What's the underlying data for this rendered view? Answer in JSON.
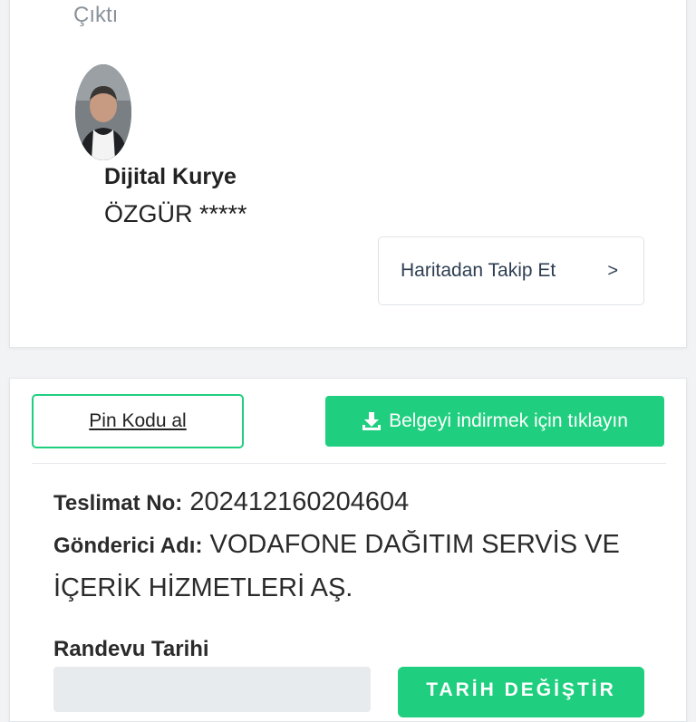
{
  "status": {
    "text": "Çıktı"
  },
  "courier": {
    "title": "Dijital Kurye",
    "name": "ÖZGÜR *****",
    "avatar_icon": "person-photo"
  },
  "map_button": {
    "label": "Haritadan Takip Et",
    "chevron": ">"
  },
  "actions": {
    "pin_label": "Pin Kodu al",
    "download_label": "Belgeyi indirmek için tıklayın",
    "download_icon": "download-icon"
  },
  "delivery": {
    "delivery_no_label": "Teslimat No:",
    "delivery_no_value": "202412160204604",
    "sender_label": "Gönderici Adı:",
    "sender_value": "VODAFONE DAĞITIM SERVİS VE İÇERİK HİZMETLERİ AŞ."
  },
  "appointment": {
    "label": "Randevu Tarihi",
    "date_value": "",
    "change_button_label": "TARİH DEĞİŞTİR"
  },
  "colors": {
    "accent_green": "#1fcf7f",
    "text_dark": "#222222",
    "muted_gray": "#8a939b"
  }
}
